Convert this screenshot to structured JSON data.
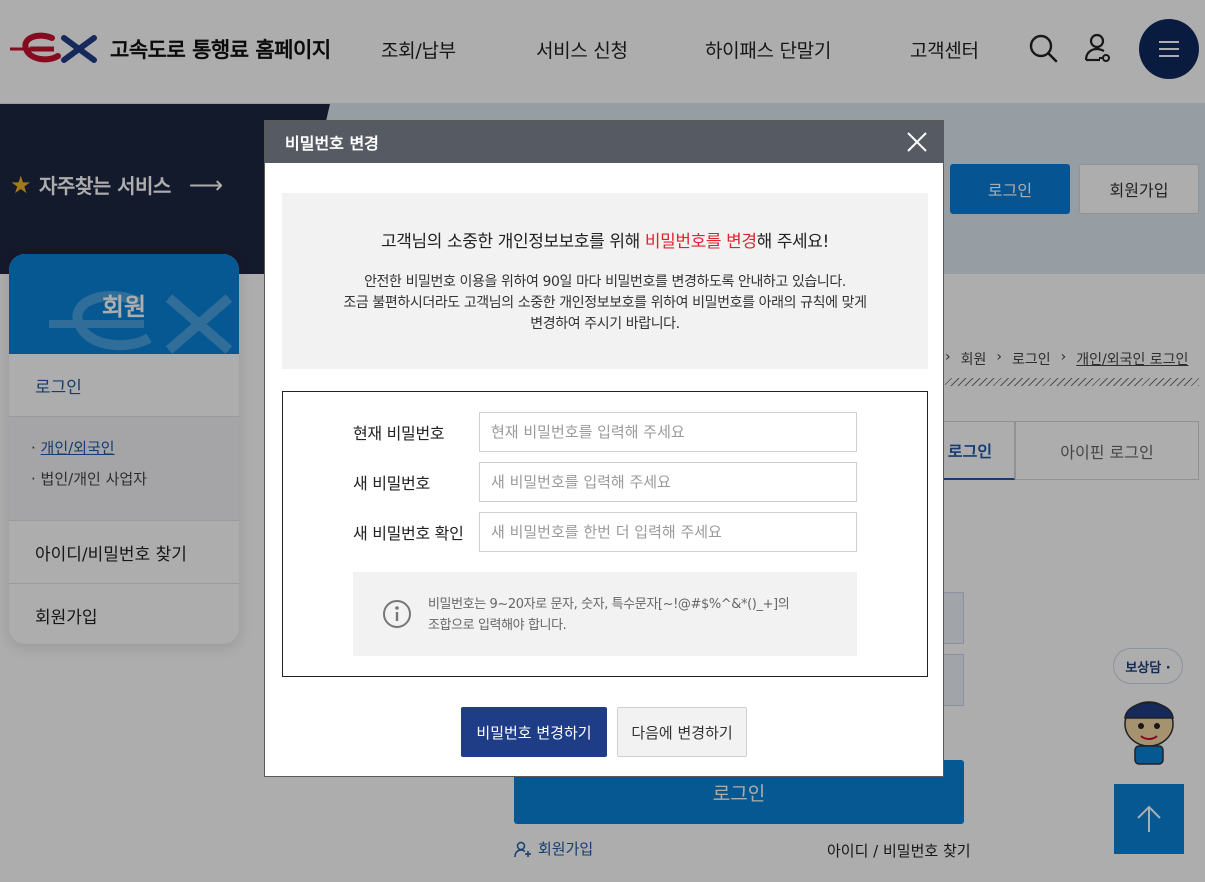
{
  "header": {
    "site_title": "고속도로 통행료 홈페이지",
    "nav": [
      "조회/납부",
      "서비스 신청",
      "하이패스 단말기",
      "고객센터"
    ]
  },
  "hero": {
    "favorite_services": "자주찾는 서비스",
    "login_button": "로그인",
    "join_button": "회원가입"
  },
  "sidebar": {
    "title": "회원",
    "login": "로그인",
    "sub_items": [
      "개인/외국인",
      "법인/개인 사업자"
    ],
    "find_id_pw": "아이디/비밀번호 찾기",
    "join": "회원가입"
  },
  "breadcrumb": [
    "회원",
    "로그인",
    "개인/외국인 로그인"
  ],
  "tabs": [
    "로그인",
    "아이핀 로그인"
  ],
  "background_form": {
    "login_button": "로그인",
    "join_link": "회원가입",
    "find_link": "아이디 / 비밀번호 찾기"
  },
  "chatbot": {
    "label": "보상담 ·"
  },
  "modal": {
    "title": "비밀번호 변경",
    "notice_lead_pre": "고객님의 소중한 개인정보보호를 위해 ",
    "notice_lead_red": "비밀번호를 변경",
    "notice_lead_post": "해 주세요!",
    "notice_line1": "안전한 비밀번호 이용을 위하여 90일 마다 비밀번호를 변경하도록 안내하고 있습니다.",
    "notice_line2": "조금 불편하시더라도 고객님의 소중한 개인정보보호를 위하여 비밀번호를 아래의 규칙에 맞게",
    "notice_line3": "변경하여 주시기 바랍니다.",
    "fields": [
      {
        "label": "현재 비밀번호",
        "placeholder": "현재 비밀번호를 입력해 주세요",
        "value": ""
      },
      {
        "label": "새 비밀번호",
        "placeholder": "새 비밀번호를 입력해 주세요",
        "value": ""
      },
      {
        "label": "새 비밀번호 확인",
        "placeholder": "새 비밀번호를 한번 더 입력해 주세요",
        "value": ""
      }
    ],
    "rule_line1": "비밀번호는 9~20자로 문자, 숫자, 특수문자[~!@#$%^&*()_+]의",
    "rule_line2": "조합으로 입력해야 합니다.",
    "change_button": "비밀번호 변경하기",
    "later_button": "다음에 변경하기"
  },
  "colors": {
    "brand_red": "#c8102e",
    "primary_blue": "#0a82d8",
    "navy": "#1f3d87",
    "highlight_red": "#e0242c"
  }
}
